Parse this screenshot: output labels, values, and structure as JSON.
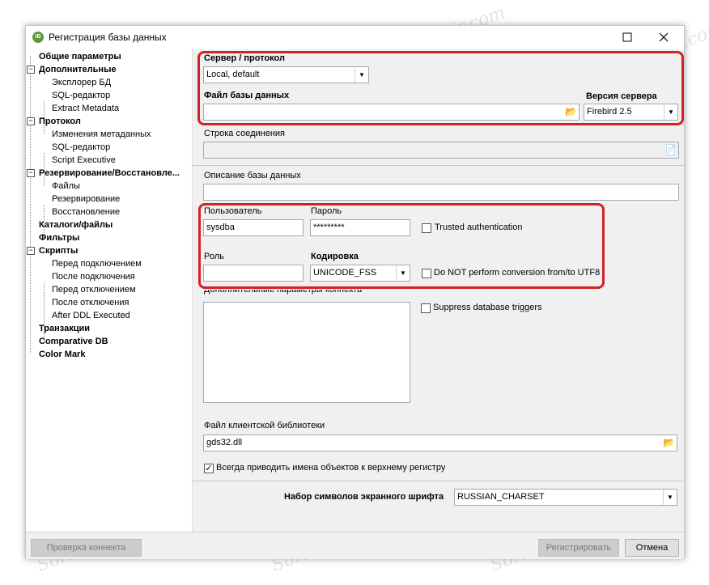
{
  "window": {
    "title": "Регистрация базы данных",
    "app_icon": "ibexpert-icon"
  },
  "tree": {
    "items": [
      {
        "label": "Общие параметры",
        "bold": true
      },
      {
        "label": "Дополнительные",
        "bold": true
      },
      {
        "label": "Эксплорер БД",
        "bold": false
      },
      {
        "label": "SQL-редактор",
        "bold": false
      },
      {
        "label": "Extract Metadata",
        "bold": false
      },
      {
        "label": "Протокол",
        "bold": true
      },
      {
        "label": "Изменения метаданных",
        "bold": false
      },
      {
        "label": "SQL-редактор",
        "bold": false
      },
      {
        "label": "Script Executive",
        "bold": false
      },
      {
        "label": "Резервирование/Восстановле...",
        "bold": true
      },
      {
        "label": "Файлы",
        "bold": false
      },
      {
        "label": "Резервирование",
        "bold": false
      },
      {
        "label": "Восстановление",
        "bold": false
      },
      {
        "label": "Каталоги/файлы",
        "bold": true
      },
      {
        "label": "Фильтры",
        "bold": true
      },
      {
        "label": "Скрипты",
        "bold": true
      },
      {
        "label": "Перед подключением",
        "bold": false
      },
      {
        "label": "После подключения",
        "bold": false
      },
      {
        "label": "Перед отключением",
        "bold": false
      },
      {
        "label": "После отключения",
        "bold": false
      },
      {
        "label": "After DDL Executed",
        "bold": false
      },
      {
        "label": "Транзакции",
        "bold": true
      },
      {
        "label": "Comparative DB",
        "bold": true
      },
      {
        "label": "Color Mark",
        "bold": true
      }
    ]
  },
  "form": {
    "server_label": "Сервер / протокол",
    "server_value": "Local, default",
    "db_file_label": "Файл базы данных",
    "db_file_value": "",
    "server_version_label": "Версия сервера",
    "server_version_value": "Firebird 2.5",
    "conn_string_label": "Строка соединения",
    "conn_string_value": "",
    "db_desc_label": "Описание базы данных",
    "db_desc_value": "",
    "user_label": "Пользователь",
    "user_value": "sysdba",
    "password_label": "Пароль",
    "password_value": "*********",
    "trusted_label": "Trusted authentication",
    "role_label": "Роль",
    "role_value": "",
    "charset_label": "Кодировка",
    "charset_value": "UNICODE_FSS",
    "no_utf8_label": "Do NOT perform conversion from/to UTF8",
    "extra_params_label": "Дополнительные параметры коннекта",
    "suppress_triggers_label": "Suppress database triggers",
    "client_lib_label": "Файл клиентской библиотеки",
    "client_lib_value": "gds32.dll",
    "uppercase_label": "Всегда приводить имена объектов к верхнему регистру",
    "uppercase_checked": true,
    "font_charset_label": "Набор символов экранного шрифта",
    "font_charset_value": "RUSSIAN_CHARSET"
  },
  "buttons": {
    "test_connect": "Проверка коннекта",
    "register": "Регистрировать",
    "cancel": "Отмена"
  },
  "watermark": "Soringpcrepair.com",
  "colors": {
    "highlight": "#d42027",
    "panel": "#f0f0f0"
  }
}
